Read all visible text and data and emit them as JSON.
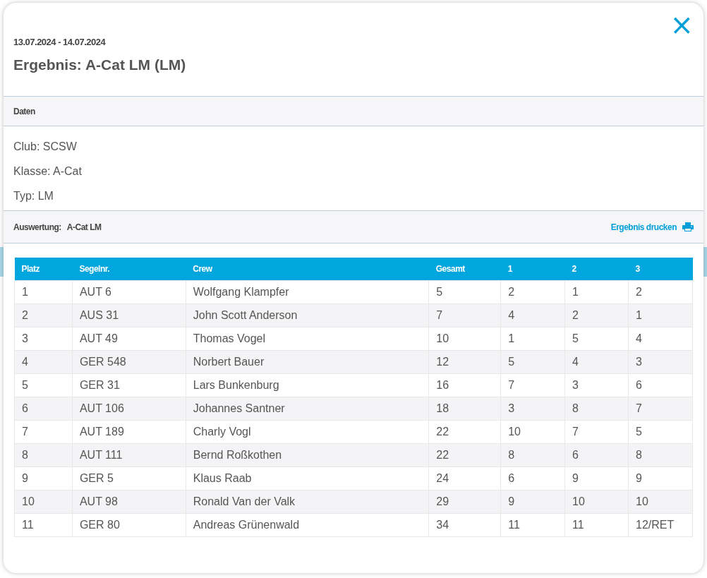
{
  "modal": {
    "close_glyph": "×",
    "date_range": "13.07.2024 - 14.07.2024",
    "title": "Ergebnis: A-Cat LM (LM)"
  },
  "data_section": {
    "heading": "Daten",
    "lines": [
      "Club: SCSW",
      "Klasse: A-Cat",
      "Typ: LM"
    ]
  },
  "evaluation_bar": {
    "label": "Auswertung:",
    "value": "A-Cat LM",
    "print_link": "Ergebnis drucken"
  },
  "table": {
    "columns": [
      "Platz",
      "Segelnr.",
      "Crew",
      "Gesamt",
      "1",
      "2",
      "3"
    ],
    "rows": [
      [
        "1",
        "AUT 6",
        "Wolfgang Klampfer",
        "5",
        "2",
        "1",
        "2"
      ],
      [
        "2",
        "AUS 31",
        "John Scott Anderson",
        "7",
        "4",
        "2",
        "1"
      ],
      [
        "3",
        "AUT 49",
        "Thomas Vogel",
        "10",
        "1",
        "5",
        "4"
      ],
      [
        "4",
        "GER 548",
        "Norbert Bauer",
        "12",
        "5",
        "4",
        "3"
      ],
      [
        "5",
        "GER 31",
        "Lars Bunkenburg",
        "16",
        "7",
        "3",
        "6"
      ],
      [
        "6",
        "AUT 106",
        "Johannes Santner",
        "18",
        "3",
        "8",
        "7"
      ],
      [
        "7",
        "AUT 189",
        "Charly Vogl",
        "22",
        "10",
        "7",
        "5"
      ],
      [
        "8",
        "AUT 111",
        "Bernd Roßkothen",
        "22",
        "8",
        "6",
        "8"
      ],
      [
        "9",
        "GER 5",
        "Klaus Raab",
        "24",
        "6",
        "9",
        "9"
      ],
      [
        "10",
        "AUT 98",
        "Ronald Van der Valk",
        "29",
        "9",
        "10",
        "10"
      ],
      [
        "11",
        "GER 80",
        "Andreas Grünenwald",
        "34",
        "11",
        "11",
        "12/RET"
      ]
    ]
  }
}
